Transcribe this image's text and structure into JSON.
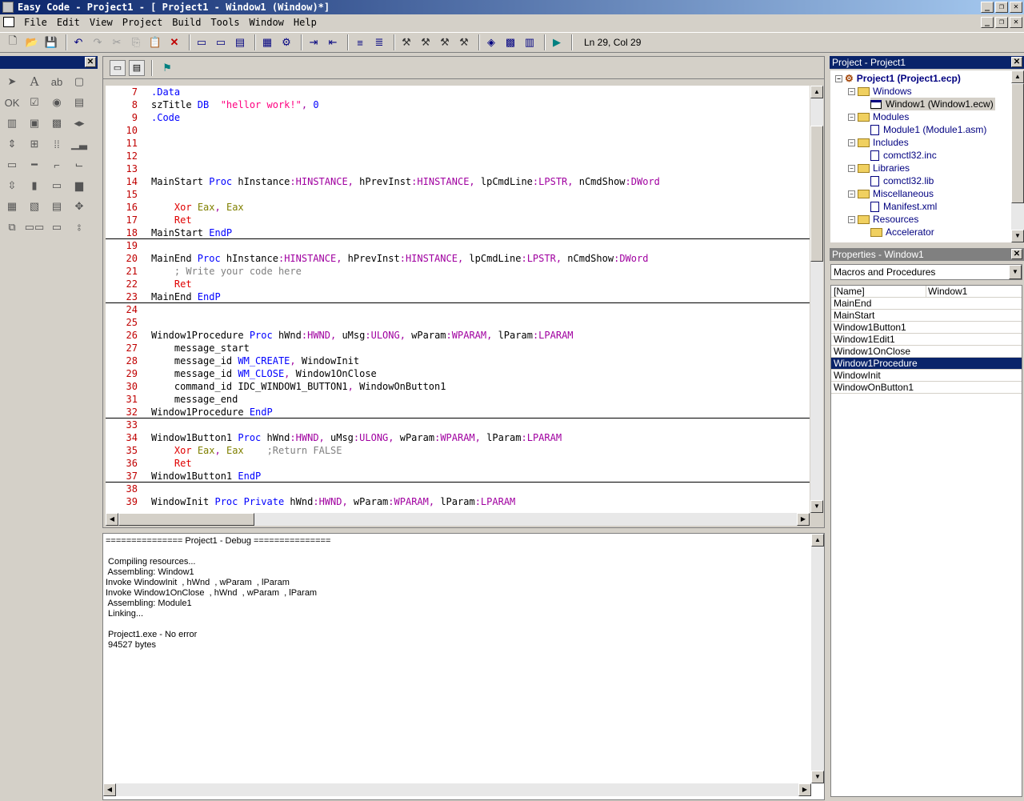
{
  "window": {
    "title": "Easy Code - Project1 - [ Project1 - Window1 (Window)*]"
  },
  "menu": [
    "File",
    "Edit",
    "View",
    "Project",
    "Build",
    "Tools",
    "Window",
    "Help"
  ],
  "toolbar": {
    "status": "Ln 29, Col 29"
  },
  "editor": {
    "lines": [
      {
        "n": "7",
        "t": ".Data"
      },
      {
        "n": "8",
        "t": "szTitle DB  \"hellor work!\", 0"
      },
      {
        "n": "9",
        "t": ".Code"
      },
      {
        "n": "10",
        "t": ""
      },
      {
        "n": "11",
        "t": ""
      },
      {
        "n": "12",
        "t": ""
      },
      {
        "n": "13",
        "t": ""
      },
      {
        "n": "14",
        "t": "MainStart Proc hInstance:HINSTANCE, hPrevInst:HINSTANCE, lpCmdLine:LPSTR, nCmdShow:DWord"
      },
      {
        "n": "15",
        "t": ""
      },
      {
        "n": "16",
        "t": "    Xor Eax, Eax"
      },
      {
        "n": "17",
        "t": "    Ret"
      },
      {
        "n": "18",
        "t": "MainStart EndP"
      },
      {
        "n": "19",
        "t": ""
      },
      {
        "n": "20",
        "t": "MainEnd Proc hInstance:HINSTANCE, hPrevInst:HINSTANCE, lpCmdLine:LPSTR, nCmdShow:DWord"
      },
      {
        "n": "21",
        "t": "    ; Write your code here"
      },
      {
        "n": "22",
        "t": "    Ret"
      },
      {
        "n": "23",
        "t": "MainEnd EndP"
      },
      {
        "n": "24",
        "t": ""
      },
      {
        "n": "25",
        "t": ""
      },
      {
        "n": "26",
        "t": "Window1Procedure Proc hWnd:HWND, uMsg:ULONG, wParam:WPARAM, lParam:LPARAM"
      },
      {
        "n": "27",
        "t": "    message_start"
      },
      {
        "n": "28",
        "t": "    message_id WM_CREATE, WindowInit"
      },
      {
        "n": "29",
        "t": "    message_id WM_CLOSE, Window1OnClose"
      },
      {
        "n": "30",
        "t": "    command_id IDC_WINDOW1_BUTTON1, WindowOnButton1"
      },
      {
        "n": "31",
        "t": "    message_end"
      },
      {
        "n": "32",
        "t": "Window1Procedure EndP"
      },
      {
        "n": "33",
        "t": ""
      },
      {
        "n": "34",
        "t": "Window1Button1 Proc hWnd:HWND, uMsg:ULONG, wParam:WPARAM, lParam:LPARAM"
      },
      {
        "n": "35",
        "t": "    Xor Eax, Eax    ;Return FALSE"
      },
      {
        "n": "36",
        "t": "    Ret"
      },
      {
        "n": "37",
        "t": "Window1Button1 EndP"
      },
      {
        "n": "38",
        "t": ""
      },
      {
        "n": "39",
        "t": "WindowInit Proc Private hWnd:HWND, wParam:WPARAM, lParam:LPARAM"
      }
    ]
  },
  "output": {
    "text": "=============== Project1 - Debug ===============\n\n Compiling resources...\n Assembling: Window1\nInvoke WindowInit  , hWnd  , wParam  , lParam\nInvoke Window1OnClose  , hWnd  , wParam  , lParam\n Assembling: Module1\n Linking...\n\n Project1.exe - No error\n 94527 bytes"
  },
  "project": {
    "title": "Project - Project1",
    "root": "Project1 (Project1.ecp)",
    "windows": "Windows",
    "window1": "Window1 (Window1.ecw)",
    "modules": "Modules",
    "module1": "Module1 (Module1.asm)",
    "includes": "Includes",
    "inc": "comctl32.inc",
    "libraries": "Libraries",
    "lib": "comctl32.lib",
    "misc": "Miscellaneous",
    "manifest": "Manifest.xml",
    "resources": "Resources",
    "accel": "Accelerator"
  },
  "properties": {
    "title": "Properties - Window1",
    "combo": "Macros and Procedures",
    "name_key": "[Name]",
    "name_val": "Window1",
    "items": [
      "MainEnd",
      "MainStart",
      "Window1Button1",
      "Window1Edit1",
      "Window1OnClose",
      "Window1Procedure",
      "WindowInit",
      "WindowOnButton1"
    ],
    "selected": "Window1Procedure"
  }
}
